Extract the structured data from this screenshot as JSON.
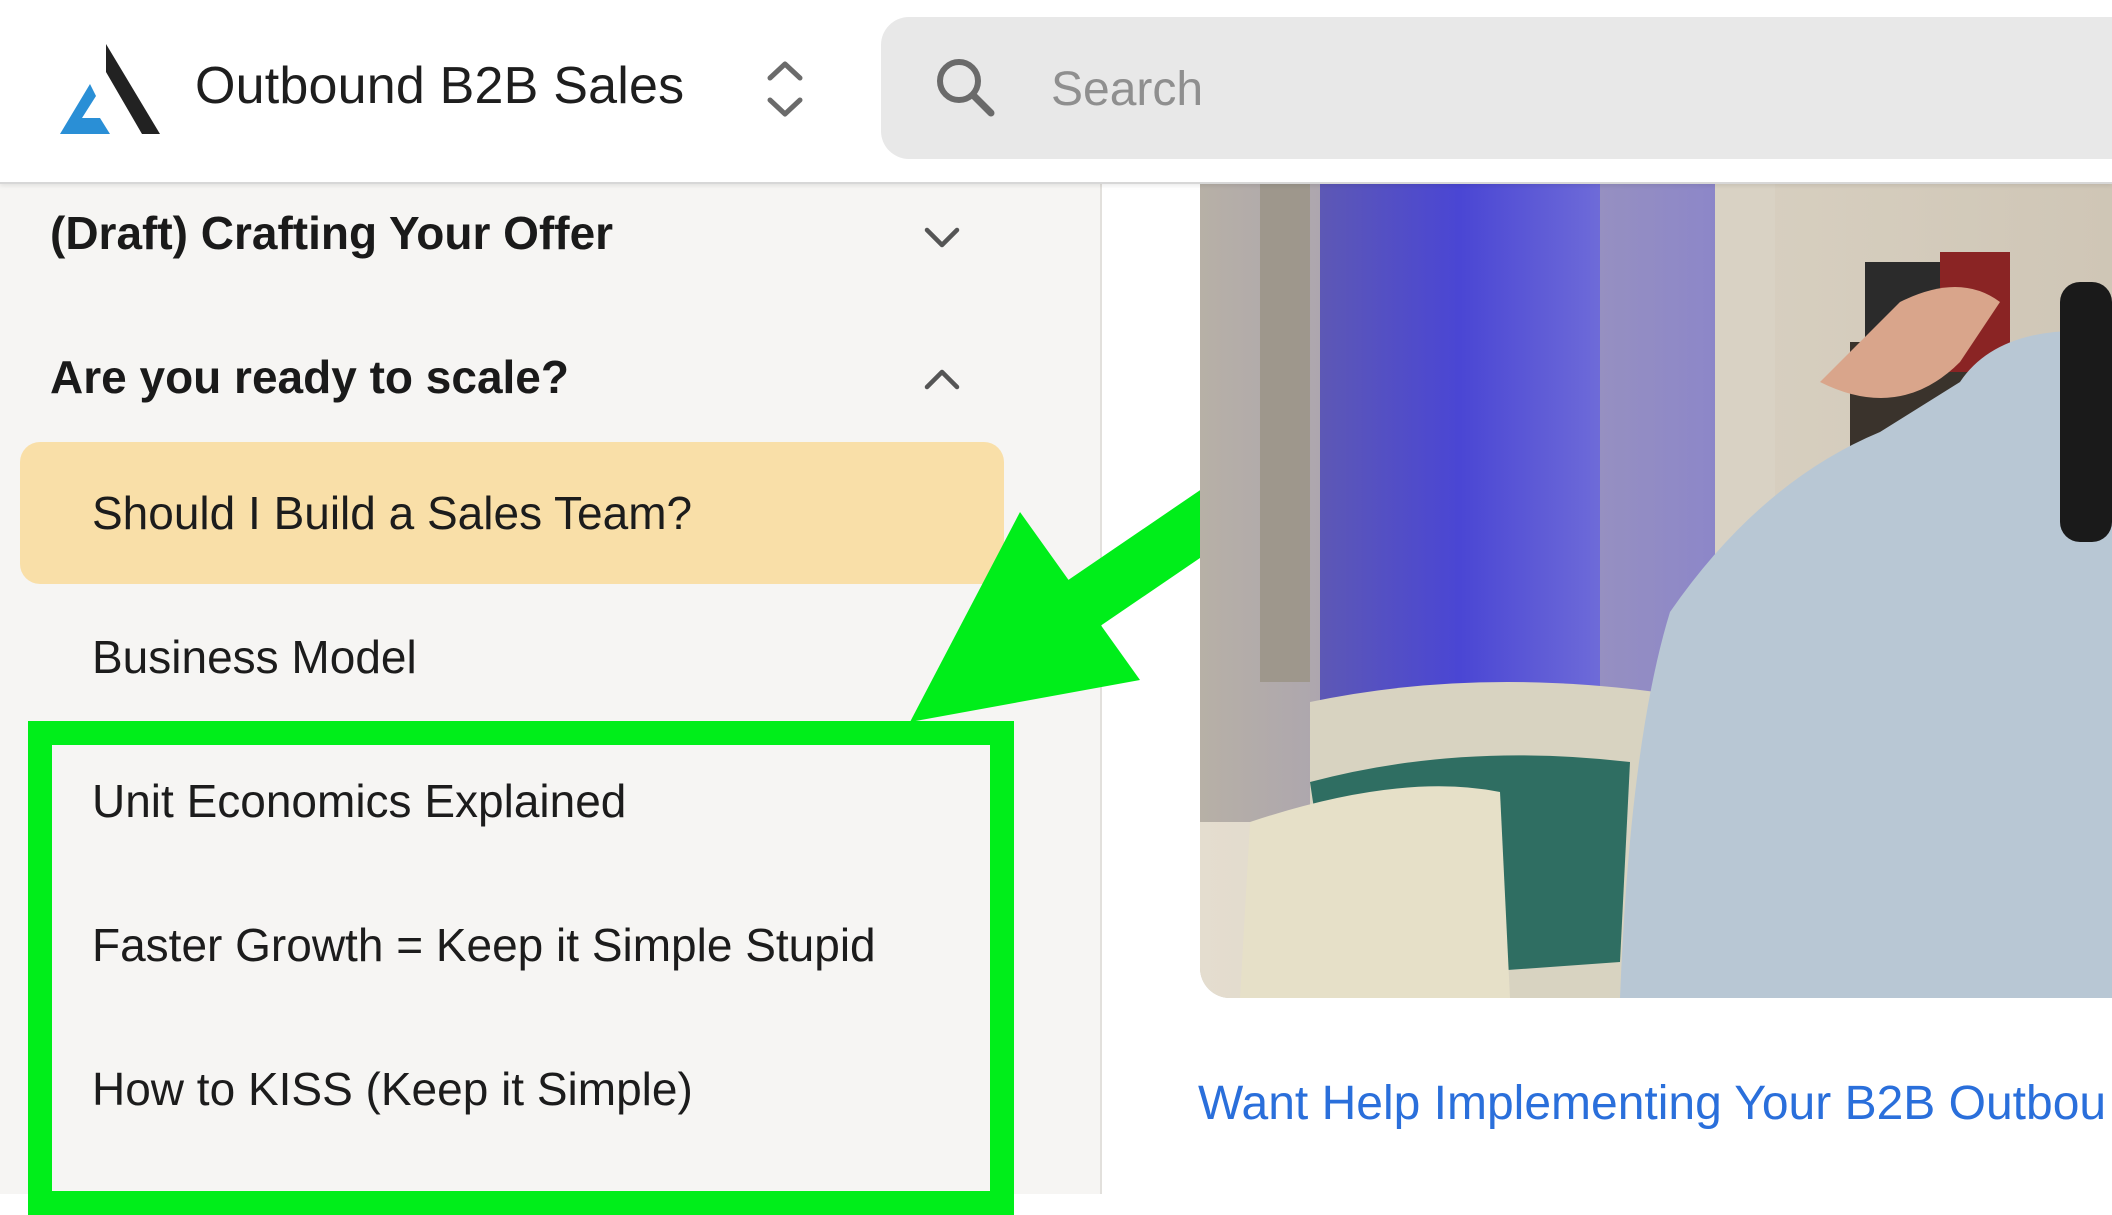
{
  "header": {
    "app_title": "Outbound B2B Sales",
    "search_placeholder": "Search",
    "icons": {
      "logo": "brand-logo-triangle",
      "switcher": "chevron-up-down-icon",
      "search": "search-icon"
    }
  },
  "sidebar": {
    "sections": [
      {
        "title": "(Draft) Crafting Your Offer",
        "expanded": false,
        "chevron": "chevron-down-icon"
      },
      {
        "title": "Are you ready to scale?",
        "expanded": true,
        "chevron": "chevron-up-icon"
      }
    ],
    "lessons": [
      {
        "label": "Should I Build a Sales Team?",
        "active": true
      },
      {
        "label": "Business Model",
        "active": false
      },
      {
        "label": "Unit Economics Explained",
        "active": false
      },
      {
        "label": "Faster Growth = Keep it Simple Stupid",
        "active": false
      },
      {
        "label": "How to KISS (Keep it Simple)",
        "active": false
      }
    ]
  },
  "main": {
    "cta_link": "Want Help Implementing Your B2B Outbou"
  },
  "colors": {
    "active_lesson_bg": "#f9dfa8",
    "annotation_green": "#00ee1a",
    "link_blue": "#2a6fdb",
    "sidebar_bg": "#f6f5f3",
    "search_bg": "#e8e8e8"
  }
}
